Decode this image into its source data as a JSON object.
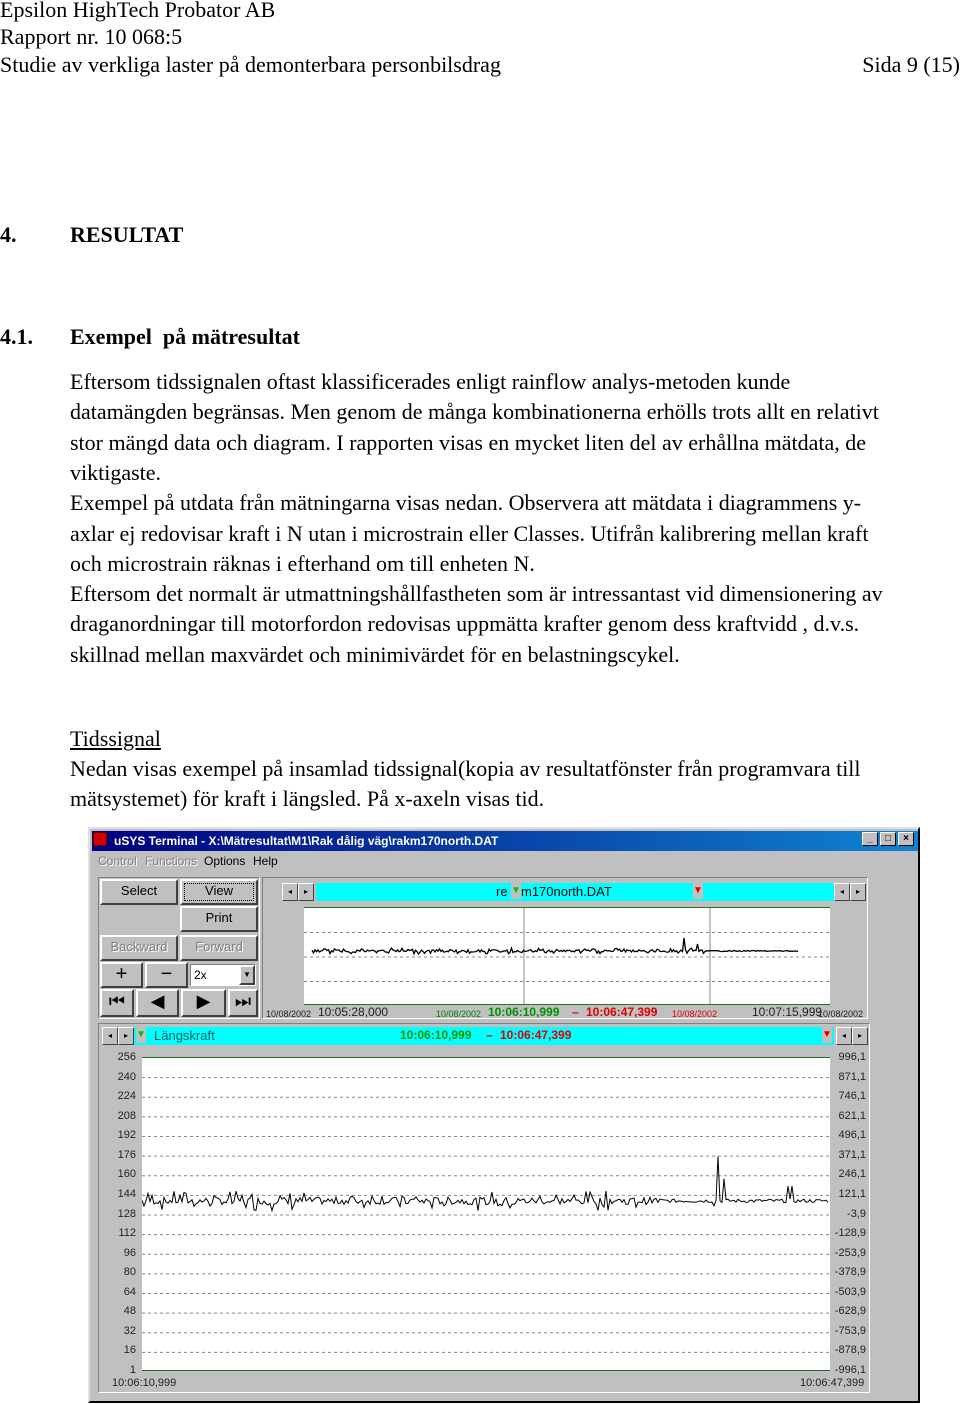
{
  "header": {
    "company": "Epsilon HighTech Probator AB",
    "report": "Rapport nr. 10 068:5",
    "study": "Studie av verkliga laster på demonterbara personbilsdrag",
    "page": "Sida 9 (15)"
  },
  "section": {
    "number": "4.",
    "title": "RESULTAT"
  },
  "subsection": {
    "number": "4.1.",
    "title": "Exempel  på mätresultat"
  },
  "body_lines": [
    "Eftersom tidssignalen oftast klassificerades enligt rainflow analys-metoden kunde",
    "datamängden begränsas. Men genom de många kombinationerna erhölls trots allt en relativt",
    "stor mängd data och diagram. I rapporten visas en mycket liten del av erhållna mätdata, de",
    "viktigaste.",
    "Exempel på utdata från mätningarna visas nedan.  Observera att mätdata i diagrammens y-",
    "axlar ej redovisar kraft i N utan i microstrain eller Classes. Utifrån kalibrering mellan kraft",
    "och microstrain räknas i efterhand om till enheten N.",
    "Eftersom det normalt är utmattningshållfastheten som är intressantast vid dimensionering av",
    "draganordningar till motorfordon redovisas uppmätta krafter genom dess kraftvidd , d.v.s.",
    "skillnad mellan maxvärdet och minimivärdet för en belastningscykel."
  ],
  "tidssignal": {
    "heading": "Tidssignal",
    "lines": [
      "Nedan visas exempel på insamlad tidssignal(kopia av resultatfönster från programvara till",
      "mätsystemet) för kraft i längsled. På x-axeln visas tid."
    ]
  },
  "window": {
    "title": "uSYS Terminal - X:\\Mätresultat\\M1\\Rak dålig väg\\rakm170north.DAT",
    "controls": {
      "minimize": "_",
      "maximize": "□",
      "close": "×"
    },
    "menu": [
      "Control",
      "Functions",
      "Options",
      "Help"
    ],
    "buttons": {
      "select": "Select",
      "view": "View",
      "print": "Print",
      "backward": "Backward",
      "forward": "Forward",
      "zoom_in": "+",
      "zoom_out": "−",
      "zoom_value": "2x"
    },
    "overview": {
      "filename_left": "re",
      "filename_right": "m170north.DAT",
      "start_date": "10/08/2002",
      "start_time": "10:05:28,000",
      "sel_date_left": "10/08/2002",
      "sel_start": "10:06:10,999",
      "dash": "–",
      "sel_end": "10:06:47,399",
      "sel_date_right": "10/08/2002",
      "end_time": "10:07:15,999",
      "end_date": "10/08/2002"
    },
    "detail": {
      "channel": "Längskraft",
      "range_start": "10:06:10,999",
      "dash": "–",
      "range_end": "10:06:47,399",
      "x_start": "10:06:10,999",
      "x_end": "10:06:47,399"
    }
  },
  "colors": {
    "titlebar": "#000080",
    "cyan": "#00ffff",
    "green_marker": "#00c000",
    "red_marker": "#e00000"
  },
  "chart_data": {
    "type": "line",
    "title": "Längskraft",
    "x_range": [
      "10:06:10,999",
      "10:06:47,399"
    ],
    "left_ticks": [
      "256",
      "240",
      "224",
      "208",
      "192",
      "176",
      "160",
      "144",
      "128",
      "112",
      "96",
      "80",
      "64",
      "48",
      "32",
      "16",
      "1"
    ],
    "right_ticks": [
      "996,1",
      "871,1",
      "746,1",
      "621,1",
      "496,1",
      "371,1",
      "246,1",
      "121,1",
      "-3,9",
      "-128,9",
      "-253,9",
      "-378,9",
      "-503,9",
      "-628,9",
      "-753,9",
      "-878,9",
      "-996,1"
    ],
    "left_range": [
      1,
      256
    ],
    "grid": true,
    "baseline_class": 140,
    "peak_class": 176
  }
}
